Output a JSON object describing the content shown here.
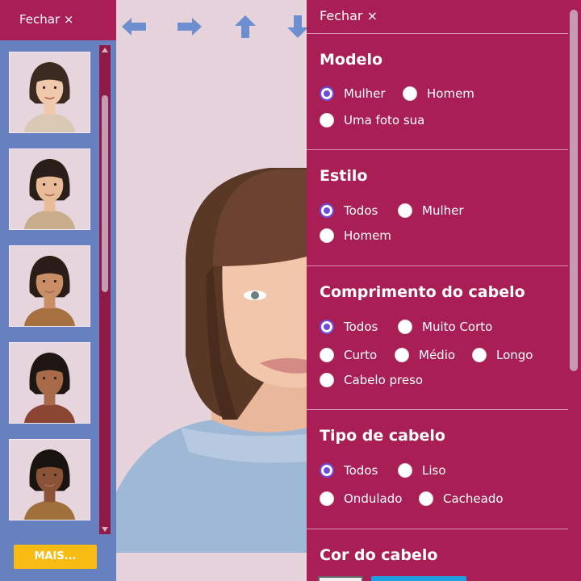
{
  "left_panel": {
    "close_label": "Fechar ×",
    "more_button": "MAIS..."
  },
  "right_panel": {
    "close_label": "Fechar ×",
    "sections": [
      {
        "title": "Modelo",
        "options": [
          {
            "label": "Mulher",
            "selected": true
          },
          {
            "label": "Homem",
            "selected": false
          },
          {
            "label": "Uma foto sua",
            "selected": false
          }
        ]
      },
      {
        "title": "Estilo",
        "options": [
          {
            "label": "Todos",
            "selected": true
          },
          {
            "label": "Mulher",
            "selected": false
          },
          {
            "label": "Homem",
            "selected": false
          }
        ]
      },
      {
        "title": "Comprimento do cabelo",
        "options": [
          {
            "label": "Todos",
            "selected": true
          },
          {
            "label": "Muito Corto",
            "selected": false
          },
          {
            "label": "Curto",
            "selected": false
          },
          {
            "label": "Médio",
            "selected": false
          },
          {
            "label": "Longo",
            "selected": false
          },
          {
            "label": "Cabelo preso",
            "selected": false
          }
        ]
      },
      {
        "title": "Tipo de cabelo",
        "options": [
          {
            "label": "Todos",
            "selected": true
          },
          {
            "label": "Liso",
            "selected": false
          },
          {
            "label": "Ondulado",
            "selected": false
          },
          {
            "label": "Cacheado",
            "selected": false
          }
        ]
      },
      {
        "title": "Cor do cabelo",
        "options": []
      }
    ]
  },
  "thumbnails": [
    {
      "skin": "#f0c9ad",
      "hair": "#3a2a20",
      "shirt": "#d8c8b4"
    },
    {
      "skin": "#e8bc98",
      "hair": "#2a1e18",
      "shirt": "#c8ad8c"
    },
    {
      "skin": "#c98e66",
      "hair": "#2a1c16",
      "shirt": "#a67040"
    },
    {
      "skin": "#a86a48",
      "hair": "#1e1612",
      "shirt": "#8a4632"
    },
    {
      "skin": "#8a5236",
      "hair": "#1a1410",
      "shirt": "#a0703a"
    }
  ],
  "nav": [
    "arrow-left",
    "arrow-right",
    "arrow-up",
    "arrow-down"
  ],
  "colors": {
    "accent": "#a91e55",
    "panel_blue": "#6680c0",
    "more_button": "#f7bb14",
    "radio_selected": "#6a4ee0",
    "nav_arrow": "#6d8fd0",
    "background": "#e7d3dc"
  }
}
